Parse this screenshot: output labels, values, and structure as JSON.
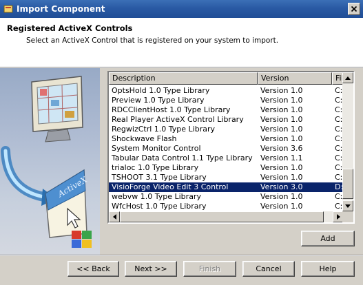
{
  "window": {
    "title": "Import Component"
  },
  "header": {
    "title": "Registered ActiveX Controls",
    "description": "Select an ActiveX Control that is registered on your system to import."
  },
  "graphic": {
    "label": "ActiveX"
  },
  "list": {
    "columns": [
      "Description",
      "Version",
      "File"
    ],
    "columns_display": [
      "Description",
      "Version",
      "File"
    ],
    "rows": [
      {
        "description": "OptsHold 1.0 Type Library",
        "version": "Version 1.0",
        "file": "C:\\",
        "selected": false
      },
      {
        "description": "Preview 1.0 Type Library",
        "version": "Version 1.0",
        "file": "C:\\",
        "selected": false
      },
      {
        "description": "RDCClientHost 1.0 Type Library",
        "version": "Version 1.0",
        "file": "C:\\",
        "selected": false
      },
      {
        "description": "Real Player ActiveX Control Library",
        "version": "Version 1.0",
        "file": "C:\\",
        "selected": false
      },
      {
        "description": "RegwizCtrl 1.0 Type Library",
        "version": "Version 1.0",
        "file": "C:\\",
        "selected": false
      },
      {
        "description": "Shockwave Flash",
        "version": "Version 1.0",
        "file": "C:\\",
        "selected": false
      },
      {
        "description": "System Monitor Control",
        "version": "Version 3.6",
        "file": "C:\\",
        "selected": false
      },
      {
        "description": "Tabular Data Control 1.1 Type Library",
        "version": "Version 1.1",
        "file": "C:\\",
        "selected": false
      },
      {
        "description": "trialoc 1.0 Type Library",
        "version": "Version 1.0",
        "file": "C:\\",
        "selected": false
      },
      {
        "description": "TSHOOT 3.1 Type Library",
        "version": "Version 1.0",
        "file": "C:\\",
        "selected": false
      },
      {
        "description": "VisioForge Video Edit 3 Control",
        "version": "Version 3.0",
        "file": "D:\\",
        "selected": true
      },
      {
        "description": "webvw 1.0 Type Library",
        "version": "Version 1.0",
        "file": "C:\\",
        "selected": false
      },
      {
        "description": "WfcHost 1.0 Type Library",
        "version": "Version 1.0",
        "file": "C:\\",
        "selected": false
      }
    ]
  },
  "buttons": {
    "add": "Add",
    "back": "<< Back",
    "next": "Next >>",
    "finish": "Finish",
    "cancel": "Cancel",
    "help": "Help"
  },
  "colors": {
    "title_bar": "#2a5aa4",
    "selection": "#0a246a",
    "dialog": "#d4d0c8"
  }
}
